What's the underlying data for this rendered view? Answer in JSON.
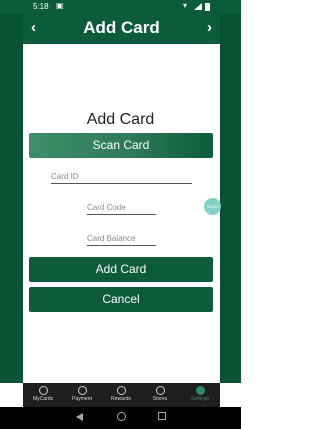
{
  "status_bar": {
    "time": "5:18",
    "wifi_icon": "wifi-icon",
    "signal_icon": "signal-icon",
    "battery_icon": "battery-icon"
  },
  "app_bar": {
    "title": "Add Card",
    "back_icon": "‹",
    "forward_icon": "›"
  },
  "main": {
    "heading": "Add Card",
    "scan_button": "Scan Card",
    "card_id_placeholder": "Card ID",
    "card_code_placeholder": "Card Code",
    "card_balance_placeholder": "Card Balance",
    "add_button": "Add Card",
    "cancel_button": "Cancel",
    "fab_label": "SCAN"
  },
  "tabs": [
    {
      "label": "MyCards"
    },
    {
      "label": "Payment"
    },
    {
      "label": "Rewards"
    },
    {
      "label": "Stores"
    },
    {
      "label": "Settings"
    }
  ],
  "colors": {
    "primary": "#0c5b3c",
    "accent": "#86cfc5"
  }
}
